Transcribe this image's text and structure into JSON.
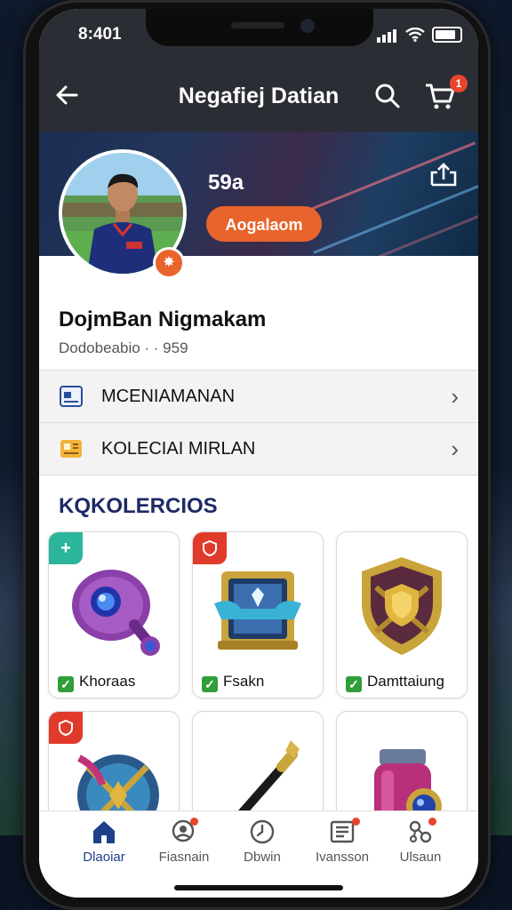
{
  "status": {
    "time": "8:401"
  },
  "appbar": {
    "title": "Negafiej Datian",
    "cart_count": "1"
  },
  "profile": {
    "stat": "59a",
    "follow_label": "Aogalaom",
    "name": "DojmBan Nigmakam",
    "subline": "Dodobeabio · · 959"
  },
  "menu": [
    {
      "label": "MCENIAMANAN",
      "icon": "id-card-icon"
    },
    {
      "label": "KOLECIAI MIRLAN",
      "icon": "collection-icon"
    }
  ],
  "section": {
    "title": "KOLERCIOS",
    "logo": "KQ"
  },
  "cards": [
    {
      "label": "Khoraas",
      "corner": "+",
      "corner_color": "#2bb59a",
      "checked": true,
      "art": "orb-gauntlet-icon"
    },
    {
      "label": "Fsakn",
      "corner": "shield",
      "corner_color": "#e03a2a",
      "checked": true,
      "art": "treasure-chest-icon"
    },
    {
      "label": "Damttaiung",
      "corner": "",
      "corner_color": "",
      "checked": true,
      "art": "shield-emblem-icon"
    },
    {
      "label": "",
      "corner": "shield",
      "corner_color": "#e03a2a",
      "checked": false,
      "art": "ornate-shield-icon"
    },
    {
      "label": "",
      "corner": "",
      "corner_color": "",
      "checked": false,
      "art": "scepter-icon"
    },
    {
      "label": "",
      "corner": "",
      "corner_color": "",
      "checked": false,
      "art": "gem-bottle-icon"
    }
  ],
  "nav": [
    {
      "label": "Dlaoiar",
      "icon": "home-icon",
      "active": true
    },
    {
      "label": "Fiasnain",
      "icon": "profile-icon",
      "active": false
    },
    {
      "label": "Dbwin",
      "icon": "clock-icon",
      "active": false
    },
    {
      "label": "Ivansson",
      "icon": "list-icon",
      "active": false
    },
    {
      "label": "Ulsaun",
      "icon": "network-icon",
      "active": false
    }
  ],
  "colors": {
    "accent": "#e8642c",
    "header": "#2a2d33",
    "nav_active": "#1f3f8a"
  }
}
